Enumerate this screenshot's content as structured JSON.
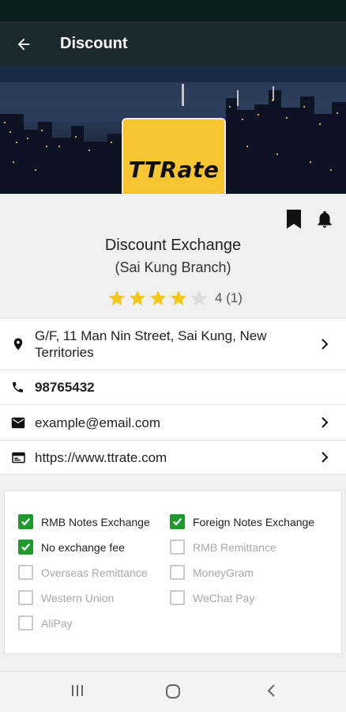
{
  "app_bar": {
    "title": "Discount",
    "back_icon": "arrow-back-icon"
  },
  "logo": {
    "text": "TTRate",
    "color": "#f7c531"
  },
  "actions": {
    "bookmark_icon": "bookmark-icon",
    "bell_icon": "bell-icon"
  },
  "shop": {
    "name": "Discount Exchange",
    "branch": "(Sai Kung Branch)",
    "rating": {
      "stars": 4,
      "max": 5,
      "text": "4 (1)",
      "star_color": "#f5c518"
    }
  },
  "info": {
    "address": "G/F, 11 Man Nin Street, Sai Kung, New Territories",
    "phone": "98765432",
    "email": "example@email.com",
    "website": "https://www.ttrate.com"
  },
  "services": [
    {
      "label": "RMB Notes Exchange",
      "checked": true
    },
    {
      "label": "Foreign Notes Exchange",
      "checked": true
    },
    {
      "label": "No exchange fee",
      "checked": true
    },
    {
      "label": "RMB Remittance",
      "checked": false
    },
    {
      "label": "Overseas Remittance",
      "checked": false
    },
    {
      "label": "MoneyGram",
      "checked": false
    },
    {
      "label": "Western Union",
      "checked": false
    },
    {
      "label": "WeChat Pay",
      "checked": false
    },
    {
      "label": "AliPay",
      "checked": false
    }
  ],
  "colors": {
    "app_bar": "#1b2a2e",
    "checked": "#1f9a2c"
  }
}
